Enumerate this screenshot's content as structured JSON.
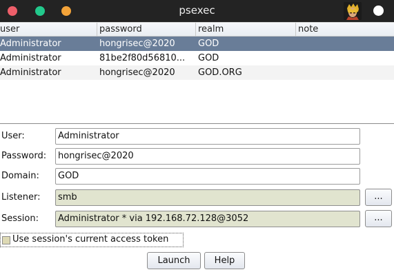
{
  "window": {
    "title": "psexec"
  },
  "table": {
    "columns": [
      "user",
      "password",
      "realm",
      "note"
    ],
    "rows": [
      {
        "user": "Administrator",
        "password": "hongrisec@2020",
        "realm": "GOD",
        "note": ""
      },
      {
        "user": "Administrator",
        "password": "81be2f80d56810...",
        "realm": "GOD",
        "note": ""
      },
      {
        "user": "Administrator",
        "password": "hongrisec@2020",
        "realm": "GOD.ORG",
        "note": ""
      }
    ],
    "selected_index": 0
  },
  "form": {
    "user_label": "User:",
    "user_value": "Administrator",
    "password_label": "Password:",
    "password_value": "hongrisec@2020",
    "domain_label": "Domain:",
    "domain_value": "GOD",
    "listener_label": "Listener:",
    "listener_value": "smb",
    "session_label": "Session:",
    "session_value": "Administrator * via  192.168.72.128@3052",
    "browse_label": "...",
    "checkbox_label": "Use session's current access token",
    "checkbox_checked": false
  },
  "buttons": {
    "launch": "Launch",
    "help": "Help"
  },
  "colors": {
    "titlebar": "#232323",
    "selected_row": "#697d98",
    "readonly_field": "#e1e4cf"
  },
  "icons": {
    "avatar": "user-avatar-icon"
  }
}
